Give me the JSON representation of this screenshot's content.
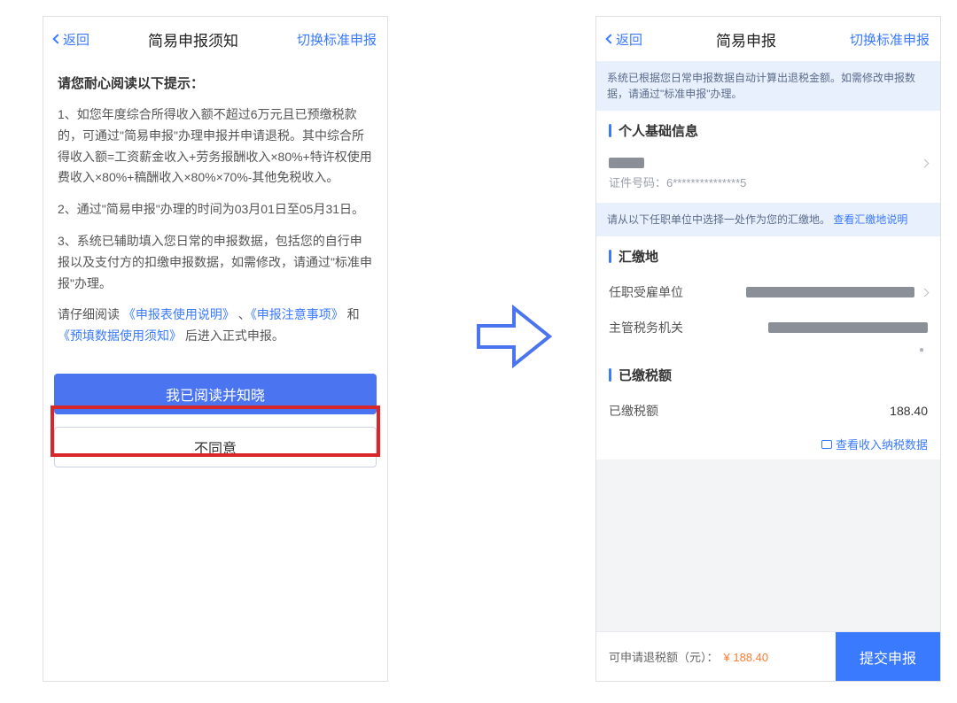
{
  "left": {
    "nav": {
      "back": "返回",
      "title": "简易申报须知",
      "action": "切换标准申报"
    },
    "heading": "请您耐心阅读以下提示：",
    "p1": "1、如您年度综合所得收入额不超过6万元且已预缴税款的，可通过\"简易申报\"办理申报并申请退税。其中综合所得收入额=工资薪金收入+劳务报酬收入×80%+特许权使用费收入×80%+稿酬收入×80%×70%-其他免税收入。",
    "p2": "2、通过\"简易申报\"办理的时间为03月01日至05月31日。",
    "p3": "3、系统已辅助填入您日常的申报数据，包括您的自行申报以及支付方的扣缴申报数据，如需修改，请通过\"标准申报\"办理。",
    "p4a": "请仔细阅读 ",
    "p4_link1": "《申报表使用说明》",
    "p4b": " 、",
    "p4_link2": "《申报注意事项》",
    "p4c": " 和 ",
    "p4_link3": "《预填数据使用须知》",
    "p4d": " 后进入正式申报。",
    "btn_agree": "我已阅读并知晓",
    "btn_disagree": "不同意"
  },
  "right": {
    "nav": {
      "back": "返回",
      "title": "简易申报",
      "action": "切换标准申报"
    },
    "banner": "系统已根据您日常申报数据自动计算出退税金额。如需修改申报数据，请通过\"标准申报\"办理。",
    "sec_basic": "个人基础信息",
    "id_label": "证件号码：",
    "id_value": "6***************5",
    "banner2a": "请从以下任职单位中选择一处作为您的汇缴地。",
    "banner2b": "查看汇缴地说明",
    "sec_place": "汇缴地",
    "row_unit": "任职受雇单位",
    "row_tax": "主管税务机关",
    "sec_paid": "已缴税额",
    "row_paid_label": "已缴税额",
    "row_paid_value": "188.40",
    "link_detail": "查看收入纳税数据",
    "footer_label": "可申请退税额（元）：",
    "footer_amount": "¥ 188.40",
    "footer_btn": "提交申报"
  }
}
